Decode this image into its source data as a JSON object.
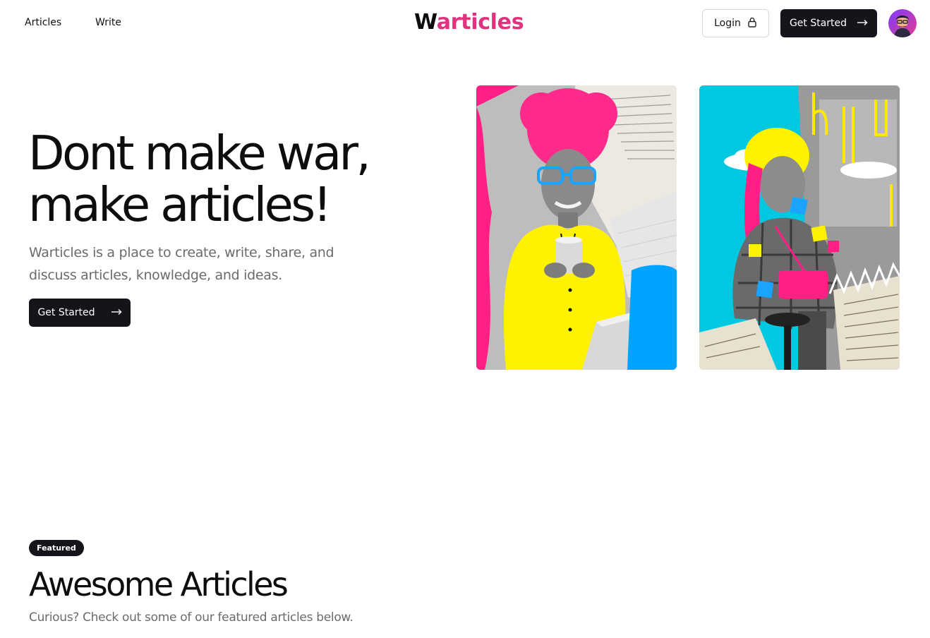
{
  "nav": {
    "articles": "Articles",
    "write": "Write"
  },
  "logo": {
    "first": "W",
    "rest": "articles"
  },
  "header": {
    "login_label": "Login",
    "get_started_label": "Get Started"
  },
  "hero": {
    "title_line1": "Dont make war,",
    "title_line2": "make articles!",
    "subtitle": "Warticles is a place to create, write, share, and discuss articles, knowledge, and ideas.",
    "cta_label": "Get Started"
  },
  "featured": {
    "badge": "Featured",
    "title": "Awesome Articles",
    "subtitle": "Curious? Check out some of our featured articles below."
  },
  "colors": {
    "accent": "#e0337f",
    "dark": "#14141b",
    "muted_text": "#6b6b6b"
  },
  "icons": {
    "login": "lock-icon",
    "cta": "arrow-right-icon",
    "avatar": "user-avatar"
  }
}
